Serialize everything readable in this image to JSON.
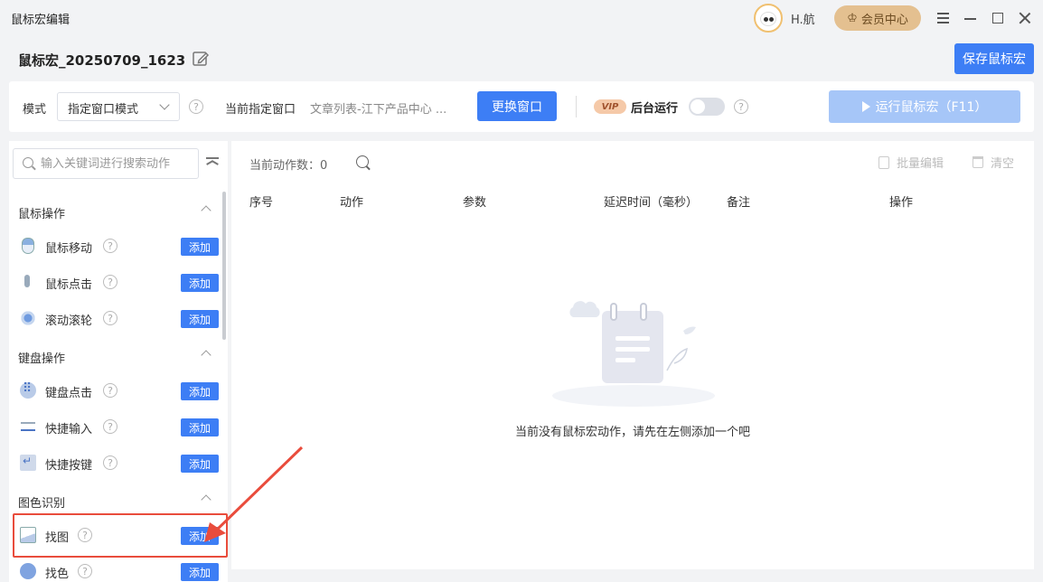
{
  "window": {
    "title": "鼠标宏编辑",
    "username": "H.航",
    "vip_center": "会员中心"
  },
  "header": {
    "macro_name": "鼠标宏_20250709_1623",
    "save_label": "保存鼠标宏"
  },
  "modebar": {
    "mode_label": "模式",
    "mode_value": "指定窗口模式",
    "current_window_label": "当前指定窗口",
    "current_window_value": "文章列表-江下产品中心 ...",
    "change_window_label": "更换窗口",
    "vip_tag": "VIP",
    "background_run_label": "后台运行",
    "background_run_enabled": false,
    "run_label": "运行鼠标宏（F11）",
    "help_glyph": "?"
  },
  "sidebar": {
    "search_placeholder": "输入关键词进行搜索动作",
    "add_label": "添加",
    "sections": [
      {
        "title": "鼠标操作",
        "items": [
          {
            "label": "鼠标移动",
            "icon": "mouse-move-icon"
          },
          {
            "label": "鼠标点击",
            "icon": "mouse-click-icon"
          },
          {
            "label": "滚动滚轮",
            "icon": "scroll-wheel-icon"
          }
        ]
      },
      {
        "title": "键盘操作",
        "items": [
          {
            "label": "键盘点击",
            "icon": "keyboard-icon"
          },
          {
            "label": "快捷输入",
            "icon": "quick-input-icon"
          },
          {
            "label": "快捷按键",
            "icon": "hotkey-icon"
          }
        ]
      },
      {
        "title": "图色识别",
        "items": [
          {
            "label": "找图",
            "icon": "find-image-icon"
          },
          {
            "label": "找色",
            "icon": "find-color-icon"
          }
        ]
      }
    ]
  },
  "main": {
    "action_count_label": "当前动作数：",
    "action_count": 0,
    "batch_edit_label": "批量编辑",
    "clear_label": "清空",
    "columns": [
      "序号",
      "动作",
      "参数",
      "延迟时间（毫秒）",
      "备注",
      "操作"
    ],
    "empty_message": "当前没有鼠标宏动作，请先在左侧添加一个吧"
  },
  "colors": {
    "primary": "#3d7ef5",
    "primary_disabled": "#a6c6f8",
    "highlight": "#e94c3c",
    "vip_gold": "#e4c090"
  }
}
